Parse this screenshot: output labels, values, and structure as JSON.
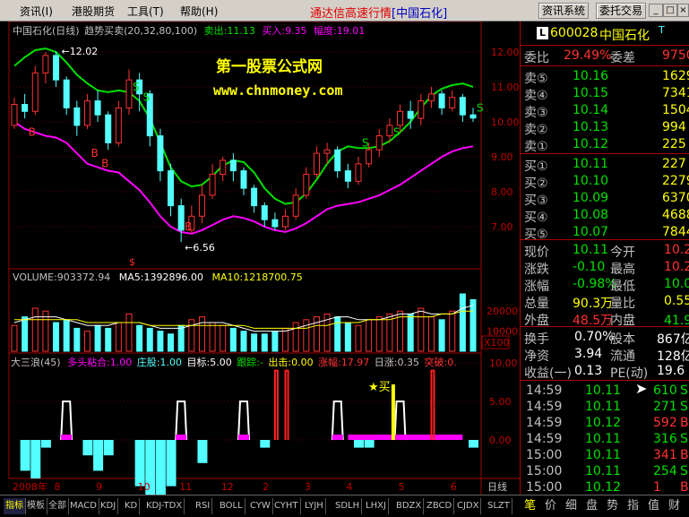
{
  "menu": {
    "items": [
      "资讯(I)",
      "港股期货",
      "工具(T)",
      "帮助(H)"
    ],
    "app_title": "通达信高速行情",
    "stock_tag": "[中国石化]",
    "btn_info": "资讯系统",
    "btn_trade": "委托交易",
    "win_min": "_",
    "win_max": "□",
    "win_close": "×"
  },
  "price_panel": {
    "header_name": "中国石化(日线)",
    "header_formula": "趋势买卖(20,32,80,100)",
    "header_sell": "卖出:11.13",
    "header_buy": "买入:9.35",
    "header_range": "幅度:19.01",
    "watermark_1": "第一股票公式网",
    "watermark_2": "www.chnmoney.com",
    "high_label": "12.02",
    "low_label": "6.56",
    "signal_s": "S",
    "signal_b": "B",
    "dollar": "$"
  },
  "volume_panel": {
    "label_volume": "VOLUME:903372.94",
    "label_ma5": "MA5:1392896.00",
    "label_ma10": "MA10:1218700.75",
    "multiplier": "X100"
  },
  "indicator_panel": {
    "name": "大三浪(45)",
    "l1": "多头粘合:1.00",
    "l2": "庄股:1.00",
    "l3": "目标:5.00",
    "l4": "跟踪:-",
    "l5": "出击:0.00",
    "l6": "涨幅:17.97",
    "l7": "日涨:0.35",
    "l8": "突破:0.",
    "buy_mark": "★买"
  },
  "chart_data": {
    "type": "candlestick",
    "price_axis": {
      "min": 6.5,
      "max": 12.5,
      "ticks": [
        12.0,
        11.0,
        10.0,
        9.0,
        8.0,
        7.0
      ]
    },
    "volume_axis": {
      "ticks": [
        20000,
        10000
      ]
    },
    "indicator_axis": {
      "ticks": [
        10.0,
        5.0,
        0.0
      ]
    },
    "time_labels": [
      "2008年",
      "8",
      "9",
      "10",
      "11",
      "12",
      "2",
      "3",
      "4",
      "5",
      "6"
    ],
    "period_label": "日线",
    "upper_band": [
      11.6,
      11.85,
      12.05,
      12.1,
      12.0,
      11.7,
      11.35,
      11.1,
      10.9,
      10.85,
      10.9,
      10.85,
      10.6,
      10.1,
      9.4,
      8.7,
      8.3,
      8.15,
      8.2,
      8.45,
      8.75,
      8.9,
      8.85,
      8.55,
      8.1,
      7.8,
      7.65,
      7.7,
      7.95,
      8.35,
      8.8,
      9.15,
      9.3,
      9.25,
      9.25,
      9.3,
      9.45,
      9.7,
      10.0,
      10.4,
      10.75,
      10.95,
      11.05,
      11.1,
      11.0
    ],
    "lower_band": [
      10.0,
      9.8,
      9.7,
      9.6,
      9.55,
      9.4,
      9.1,
      8.8,
      8.7,
      8.6,
      8.55,
      8.3,
      8.05,
      7.7,
      7.3,
      7.0,
      6.85,
      6.8,
      6.9,
      7.05,
      7.2,
      7.3,
      7.25,
      7.15,
      7.0,
      6.9,
      6.85,
      6.95,
      7.1,
      7.3,
      7.5,
      7.6,
      7.65,
      7.7,
      7.8,
      7.9,
      8.05,
      8.2,
      8.4,
      8.6,
      8.8,
      9.0,
      9.15,
      9.25,
      9.3
    ],
    "candles": [
      [
        9.9,
        10.5,
        10.7,
        9.8
      ],
      [
        10.5,
        10.3,
        10.8,
        10.1
      ],
      [
        10.3,
        11.4,
        11.6,
        10.2
      ],
      [
        11.4,
        11.9,
        12.0,
        11.1
      ],
      [
        11.9,
        11.2,
        12.02,
        11.0
      ],
      [
        11.2,
        10.4,
        11.3,
        10.2
      ],
      [
        10.4,
        9.9,
        10.6,
        9.6
      ],
      [
        9.9,
        10.6,
        10.8,
        9.8
      ],
      [
        10.6,
        10.2,
        10.9,
        10.0
      ],
      [
        10.2,
        9.4,
        10.3,
        9.2
      ],
      [
        9.4,
        10.4,
        10.6,
        9.3
      ],
      [
        10.4,
        11.2,
        11.5,
        10.2
      ],
      [
        11.2,
        10.8,
        11.4,
        10.3
      ],
      [
        10.8,
        9.6,
        10.9,
        9.3
      ],
      [
        9.6,
        8.6,
        9.8,
        8.3
      ],
      [
        8.6,
        7.6,
        8.8,
        7.3
      ],
      [
        7.6,
        6.9,
        7.8,
        6.56
      ],
      [
        6.9,
        7.3,
        7.6,
        6.8
      ],
      [
        7.3,
        7.9,
        8.2,
        7.1
      ],
      [
        7.9,
        8.5,
        8.8,
        7.8
      ],
      [
        8.5,
        8.9,
        9.0,
        8.3
      ],
      [
        8.9,
        8.6,
        9.1,
        8.3
      ],
      [
        8.6,
        8.1,
        8.7,
        7.9
      ],
      [
        8.1,
        7.6,
        8.2,
        7.4
      ],
      [
        7.6,
        7.2,
        7.7,
        7.0
      ],
      [
        7.2,
        7.0,
        7.4,
        6.9
      ],
      [
        7.0,
        7.3,
        7.5,
        6.9
      ],
      [
        7.3,
        7.9,
        8.1,
        7.2
      ],
      [
        7.9,
        8.5,
        8.7,
        7.8
      ],
      [
        8.5,
        9.1,
        9.3,
        8.4
      ],
      [
        9.1,
        9.2,
        9.4,
        8.8
      ],
      [
        9.2,
        8.6,
        9.3,
        8.4
      ],
      [
        8.6,
        8.3,
        8.8,
        8.1
      ],
      [
        8.3,
        8.8,
        9.0,
        8.2
      ],
      [
        8.8,
        9.2,
        9.4,
        8.7
      ],
      [
        9.2,
        9.6,
        9.8,
        9.0
      ],
      [
        9.6,
        9.9,
        10.1,
        9.4
      ],
      [
        9.9,
        10.3,
        10.5,
        9.7
      ],
      [
        10.3,
        10.1,
        10.6,
        9.8
      ],
      [
        10.1,
        10.6,
        10.8,
        9.9
      ],
      [
        10.6,
        10.8,
        11.0,
        10.4
      ],
      [
        10.8,
        10.4,
        10.9,
        10.2
      ],
      [
        10.4,
        10.7,
        10.9,
        10.3
      ],
      [
        10.7,
        10.2,
        10.8,
        10.0
      ],
      [
        10.2,
        10.11,
        10.4,
        10.0
      ]
    ],
    "volume": [
      9,
      12,
      15,
      14,
      10,
      11,
      8,
      7,
      9,
      8,
      10,
      13,
      9,
      8,
      7,
      6,
      9,
      11,
      12,
      10,
      9,
      8,
      7,
      6,
      6,
      7,
      8,
      10,
      11,
      12,
      13,
      12,
      10,
      9,
      11,
      12,
      13,
      14,
      13,
      15,
      12,
      11,
      14,
      20,
      18
    ],
    "ma5": [
      10,
      11,
      12,
      12,
      12,
      11,
      10,
      9,
      9,
      9,
      10,
      10,
      10,
      9,
      8,
      8,
      8,
      9,
      10,
      10,
      10,
      9,
      8,
      7,
      7,
      7,
      7,
      8,
      9,
      10,
      11,
      12,
      12,
      11,
      11,
      11,
      12,
      13,
      13,
      14,
      13,
      13,
      13,
      15,
      16
    ],
    "ma10": [
      11,
      11,
      11,
      11,
      11,
      11,
      11,
      10,
      10,
      10,
      10,
      10,
      10,
      9,
      9,
      9,
      9,
      9,
      9,
      9,
      9,
      9,
      9,
      8,
      8,
      8,
      8,
      8,
      8,
      9,
      9,
      10,
      10,
      10,
      11,
      11,
      11,
      12,
      12,
      12,
      12,
      13,
      13,
      14,
      14
    ],
    "indicator": [
      0.6,
      -4,
      -5,
      -1,
      0,
      5,
      0,
      -2,
      -4,
      -2,
      0,
      0,
      -6,
      -8,
      -10,
      -6,
      5,
      0,
      -3,
      0,
      0,
      0,
      5,
      0,
      -1,
      0,
      0,
      0,
      0,
      0,
      0,
      5,
      0,
      -1,
      -1,
      0,
      0,
      5,
      0,
      0,
      0,
      0,
      0,
      0,
      -1
    ]
  },
  "quote": {
    "code": "600028",
    "name": "中国石化",
    "badge": "L",
    "weibi_label": "委比",
    "weibi_value": "29.49%",
    "weicha_label": "委差",
    "weicha_value": "9750",
    "asks": [
      {
        "label": "卖⑤",
        "price": "10.16",
        "vol": "1629"
      },
      {
        "label": "卖④",
        "price": "10.15",
        "vol": "7341"
      },
      {
        "label": "卖③",
        "price": "10.14",
        "vol": "1504"
      },
      {
        "label": "卖②",
        "price": "10.13",
        "vol": "994"
      },
      {
        "label": "卖①",
        "price": "10.12",
        "vol": "225"
      }
    ],
    "bids": [
      {
        "label": "买①",
        "price": "10.11",
        "vol": "227"
      },
      {
        "label": "买②",
        "price": "10.10",
        "vol": "2279"
      },
      {
        "label": "买③",
        "price": "10.09",
        "vol": "6370"
      },
      {
        "label": "买④",
        "price": "10.08",
        "vol": "4688"
      },
      {
        "label": "买⑤",
        "price": "10.07",
        "vol": "7844"
      }
    ],
    "stats": [
      {
        "l1": "现价",
        "v1": "10.11",
        "l2": "今开",
        "v2": "10.23"
      },
      {
        "l1": "涨跌",
        "v1": "-0.10",
        "l2": "最高",
        "v2": "10.27"
      },
      {
        "l1": "涨幅",
        "v1": "-0.98%",
        "l2": "最低",
        "v2": "10.05"
      },
      {
        "l1": "总量",
        "v1": "90.3万",
        "l2": "量比",
        "v2": "0.55"
      },
      {
        "l1": "外盘",
        "v1": "48.5万",
        "l2": "内盘",
        "v2": "41.9万"
      }
    ],
    "stats2": [
      {
        "l1": "换手",
        "v1": "0.70%",
        "l2": "股本",
        "v2": "867亿"
      },
      {
        "l1": "净资",
        "v1": "3.94",
        "l2": "流通",
        "v2": "128亿"
      },
      {
        "l1": "收益(一)",
        "v1": "0.13",
        "l2": "PE(动)",
        "v2": "19.6"
      }
    ],
    "ticks": [
      {
        "time": "14:59",
        "price": "10.11",
        "vol": "610",
        "bs": "S"
      },
      {
        "time": "14:59",
        "price": "10.11",
        "vol": "271",
        "bs": "S"
      },
      {
        "time": "14:59",
        "price": "10.12",
        "vol": "592",
        "bs": "B"
      },
      {
        "time": "14:59",
        "price": "10.11",
        "vol": "316",
        "bs": "S"
      },
      {
        "time": "15:00",
        "price": "10.11",
        "vol": "341",
        "bs": "B"
      },
      {
        "time": "15:00",
        "price": "10.11",
        "vol": "254",
        "bs": "S"
      },
      {
        "time": "15:00",
        "price": "10.12",
        "vol": "1",
        "bs": "B"
      }
    ]
  },
  "bottom_tabs": [
    "指标",
    "模板",
    "全部",
    "MACD",
    "KDJ",
    "KD",
    "KDJ-TDX",
    "RSI",
    "BOLL",
    "CYW",
    "CYHT",
    "LYJH",
    "SDLH",
    "LHXJ",
    "BDZX",
    "ZBCD",
    "CJDX",
    "SLZT"
  ],
  "right_tabs": [
    "笔",
    "价",
    "细",
    "盘",
    "势",
    "指",
    "值",
    "财"
  ],
  "colors": {
    "up": "#ff3232",
    "down": "#54ffff",
    "upper_band": "#00e000",
    "lower_band": "#ff00ff",
    "grid": "#a00000"
  }
}
